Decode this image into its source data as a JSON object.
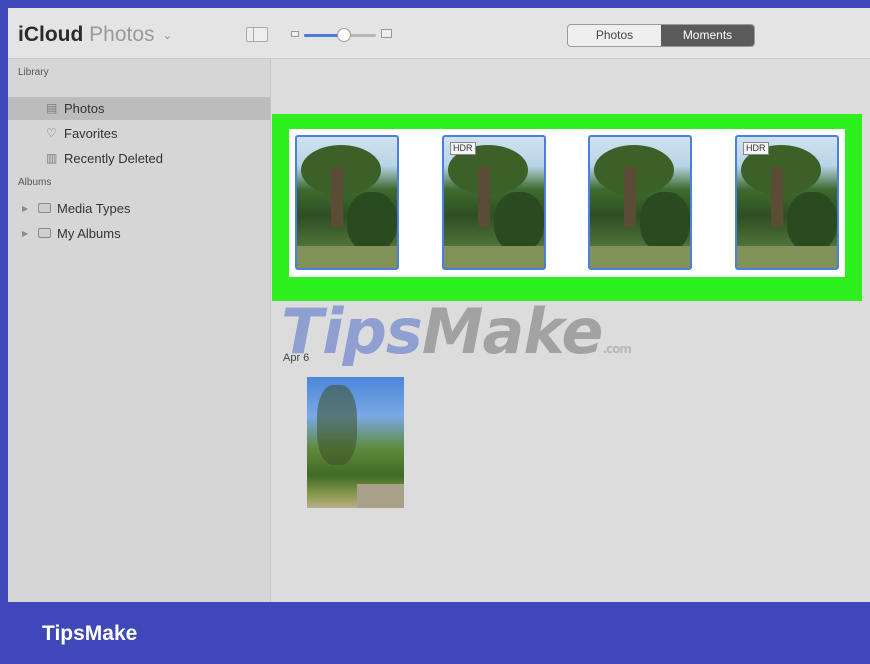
{
  "app": {
    "title_bold": "iCloud",
    "title_light": "Photos",
    "title_caret": "⌄"
  },
  "toolbar": {
    "zoom_level": 0.55,
    "segments": [
      {
        "label": "Photos",
        "active": false
      },
      {
        "label": "Moments",
        "active": true
      }
    ]
  },
  "sidebar": {
    "library_label": "Library",
    "library_items": [
      {
        "label": "Photos",
        "icon": "photos-icon",
        "selected": true
      },
      {
        "label": "Favorites",
        "icon": "heart-icon",
        "selected": false
      },
      {
        "label": "Recently Deleted",
        "icon": "trash-icon",
        "selected": false
      }
    ],
    "albums_label": "Albums",
    "album_groups": [
      {
        "label": "Media Types",
        "icon": "folder-icon"
      },
      {
        "label": "My Albums",
        "icon": "folder-icon"
      }
    ]
  },
  "main": {
    "selected_photos": [
      {
        "badge": ""
      },
      {
        "badge": "HDR"
      },
      {
        "badge": ""
      },
      {
        "badge": "HDR"
      }
    ],
    "moment_date": "Apr 6"
  },
  "watermark": {
    "part1": "Tips",
    "part2": "Make",
    "part3": ".com"
  },
  "footer": {
    "brand": "TipsMake"
  },
  "colors": {
    "highlight": "#2ff01f",
    "brand_bar": "#3f48b8",
    "selection_border": "#4a7fe0"
  }
}
